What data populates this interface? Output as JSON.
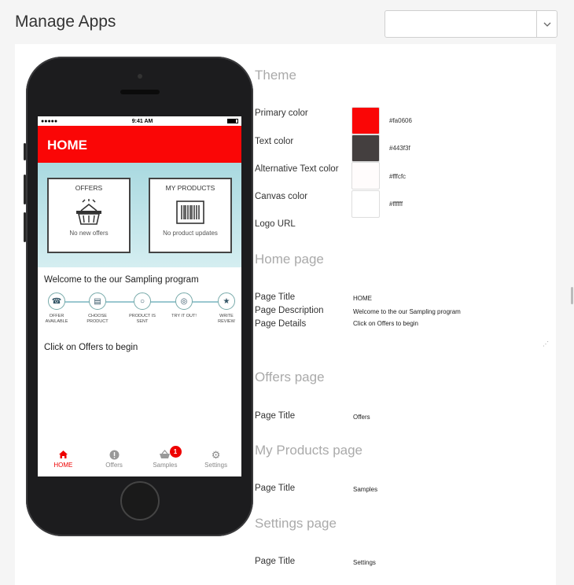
{
  "header": {
    "title": "Manage Apps"
  },
  "top_select": {
    "value": "",
    "caret": "chevron-down-icon"
  },
  "phone": {
    "status": {
      "signal": "●●●●●",
      "time": "9:41 AM"
    },
    "app_title": "HOME",
    "cards": [
      {
        "title": "OFFERS",
        "subtitle": "No new offers",
        "icon": "basket-icon"
      },
      {
        "title": "MY PRODUCTS",
        "subtitle": "No product updates",
        "icon": "barcode-icon"
      }
    ],
    "welcome": "Welcome to the our Sampling program",
    "steps": [
      {
        "label": "OFFER AVAILABLE",
        "icon": "bell-icon"
      },
      {
        "label": "CHOOSE PRODUCT",
        "icon": "barcode-icon"
      },
      {
        "label": "PRODUCT IS SENT",
        "icon": "globe-icon"
      },
      {
        "label": "TRY IT OUT!",
        "icon": "target-icon"
      },
      {
        "label": "WRITE REVIEW",
        "icon": "phone-star-icon"
      }
    ],
    "click_text": "Click on Offers to begin",
    "tabs": [
      {
        "label": "HOME",
        "icon": "home-icon",
        "active": true
      },
      {
        "label": "Offers",
        "icon": "alert-icon"
      },
      {
        "label": "Samples",
        "icon": "basket-icon",
        "badge": "1"
      },
      {
        "label": "Settings",
        "icon": "gear-icon"
      }
    ]
  },
  "theme": {
    "title": "Theme",
    "primary_label": "Primary color",
    "primary_hex": "#fa0606",
    "text_label": "Text color",
    "text_hex": "#443f3f",
    "alt_label": "Alternative Text color",
    "alt_hex": "#fffcfc",
    "canvas_label": "Canvas color",
    "canvas_hex": "#ffffff",
    "logo_label": "Logo URL"
  },
  "home_page": {
    "title": "Home page",
    "page_title_label": "Page Title",
    "page_title_value": "HOME",
    "desc_label": "Page Description",
    "desc_value": "Welcome to the our Sampling program",
    "details_label": "Page Details",
    "details_value": "Click on Offers to begin"
  },
  "offers_page": {
    "title": "Offers page",
    "page_title_label": "Page Title",
    "page_title_value": "Offers"
  },
  "products_page": {
    "title": "My Products page",
    "page_title_label": "Page Title",
    "page_title_value": "Samples"
  },
  "settings_page": {
    "title": "Settings page",
    "page_title_label": "Page Title",
    "page_title_value": "Settings"
  }
}
